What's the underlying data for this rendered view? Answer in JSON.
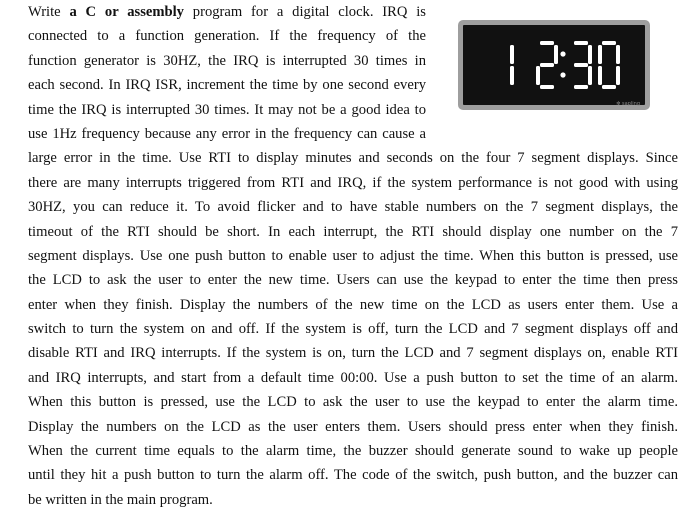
{
  "problem": {
    "first_line": {
      "pre": "Write ",
      "bold": "a C or assembly",
      "post": " program for a digital clock. IRQ is"
    },
    "narrow_lines": [
      "connected to a function generation. If the frequency of the",
      "function generator is 30HZ, the IRQ is interrupted 30 times in",
      "each second. In IRQ ISR, increment the time by one second every",
      "time the IRQ is interrupted 30 times. It may not be a good idea to",
      "use 1Hz frequency because any error in the frequency can cause a"
    ],
    "wide_lines": [
      "large error in the time. Use RTI to display minutes and seconds on the four 7 segment displays. Since",
      "there are many interrupts triggered from RTI and IRQ, if the system performance is not good with using",
      "30HZ, you can reduce it. To avoid flicker and to have stable numbers on the 7 segment displays, the",
      "timeout of the RTI should be short. In each interrupt, the RTI should display one number on the 7",
      "segment displays. Use one push button to enable user to adjust the time. When this button is pressed, use",
      "the LCD to ask the user to enter the new time. Users can use the keypad to enter the time then press",
      "enter when they finish. Display the numbers of the new time on the LCD as users enter them. Use a",
      "switch to turn the system on and off. If the system is off, turn the LCD and 7 segment displays off and",
      "disable RTI and IRQ interrupts. If the system is on, turn the LCD and 7 segment displays on, enable RTI",
      "and IRQ interrupts, and start from a default time 00:00. Use a push button to set the time of an alarm.",
      "When this button is pressed, use the LCD to ask the user to use the keypad to enter the alarm time.",
      "Display the numbers on the LCD as the user enters them. Users should press enter when they finish.",
      "When the current time equals to the alarm time, the buzzer should generate sound to wake up people",
      "until they hit a push button to turn the alarm off. The code of the switch, push button, and the buzzer can"
    ],
    "final_line": "be written in the main program."
  },
  "clock_image": {
    "time": "12:30",
    "digits": [
      "1",
      "2",
      "3",
      "0"
    ],
    "brand": "sapling",
    "frame_color": "#9e9e9e",
    "face_color": "#111111",
    "segment_color": "#ffffff"
  }
}
